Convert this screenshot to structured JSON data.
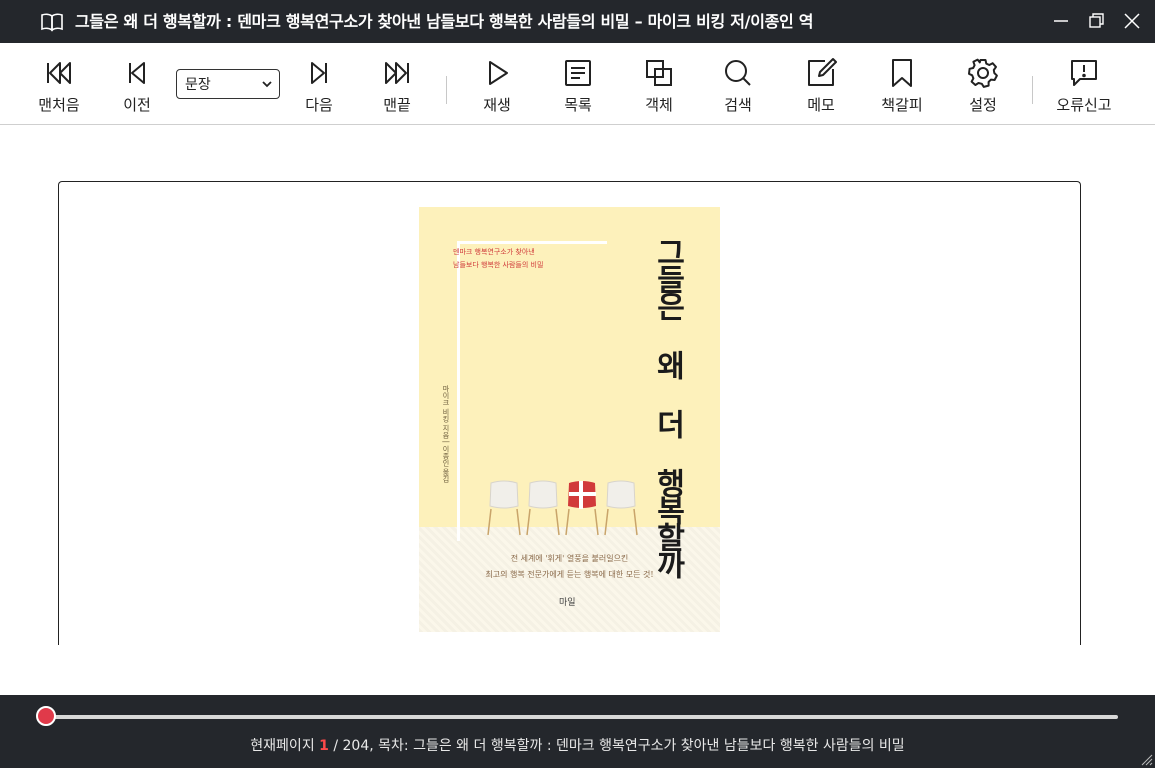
{
  "window": {
    "title": "그들은 왜 더 행복할까 : 덴마크 행복연구소가 찾아낸 남들보다 행복한 사람들의 비밀 – 마이크 비킹 저/이종인 역",
    "icon": "open-book-icon",
    "controls": [
      "minimize-icon",
      "restore-icon",
      "close-icon"
    ]
  },
  "toolbar": {
    "first": {
      "label": "맨처음",
      "icon": "skip-to-first-icon"
    },
    "prev": {
      "label": "이전",
      "icon": "step-back-icon"
    },
    "mode_select": {
      "value": "문장",
      "options": [
        "문장"
      ]
    },
    "next": {
      "label": "다음",
      "icon": "step-forward-icon"
    },
    "last": {
      "label": "맨끝",
      "icon": "skip-to-last-icon"
    },
    "play": {
      "label": "재생",
      "icon": "play-icon"
    },
    "toc": {
      "label": "목록",
      "icon": "list-document-icon"
    },
    "objects": {
      "label": "객체",
      "icon": "overlapping-squares-icon"
    },
    "search": {
      "label": "검색",
      "icon": "search-icon"
    },
    "memo": {
      "label": "메모",
      "icon": "edit-note-icon"
    },
    "bookmark": {
      "label": "책갈피",
      "icon": "bookmark-icon"
    },
    "settings": {
      "label": "설정",
      "icon": "gear-icon"
    },
    "report": {
      "label": "오류신고",
      "icon": "report-bubble-icon"
    }
  },
  "cover": {
    "subtitle_line1": "덴마크 행복연구소가 찾아낸",
    "subtitle_line2": "남들보다 행복한 사람들의 비밀",
    "title": "그들은 왜 더 행복할까",
    "author": "마이크 비킹 지음 | 이종인 옮김",
    "tagline_line1": "전 세계에 '휘게' 열풍을 불러일으킨",
    "tagline_line2": "최고의 행복 전문가에게 듣는 행복에 대한 모든 것!",
    "publisher": "마일",
    "colors": {
      "background": "#fdf1bb",
      "accent": "#d03a3a"
    }
  },
  "status": {
    "current_label": "현재페이지",
    "current_page": "1",
    "total_text": "/ 204,",
    "toc_label": "목차:",
    "toc_title": "그들은 왜 더 행복할까 : 덴마크 행복연구소가 찾아낸 남들보다 행복한 사람들의 비밀",
    "progress_fraction": 0.0,
    "accent": "#e03a4a"
  }
}
